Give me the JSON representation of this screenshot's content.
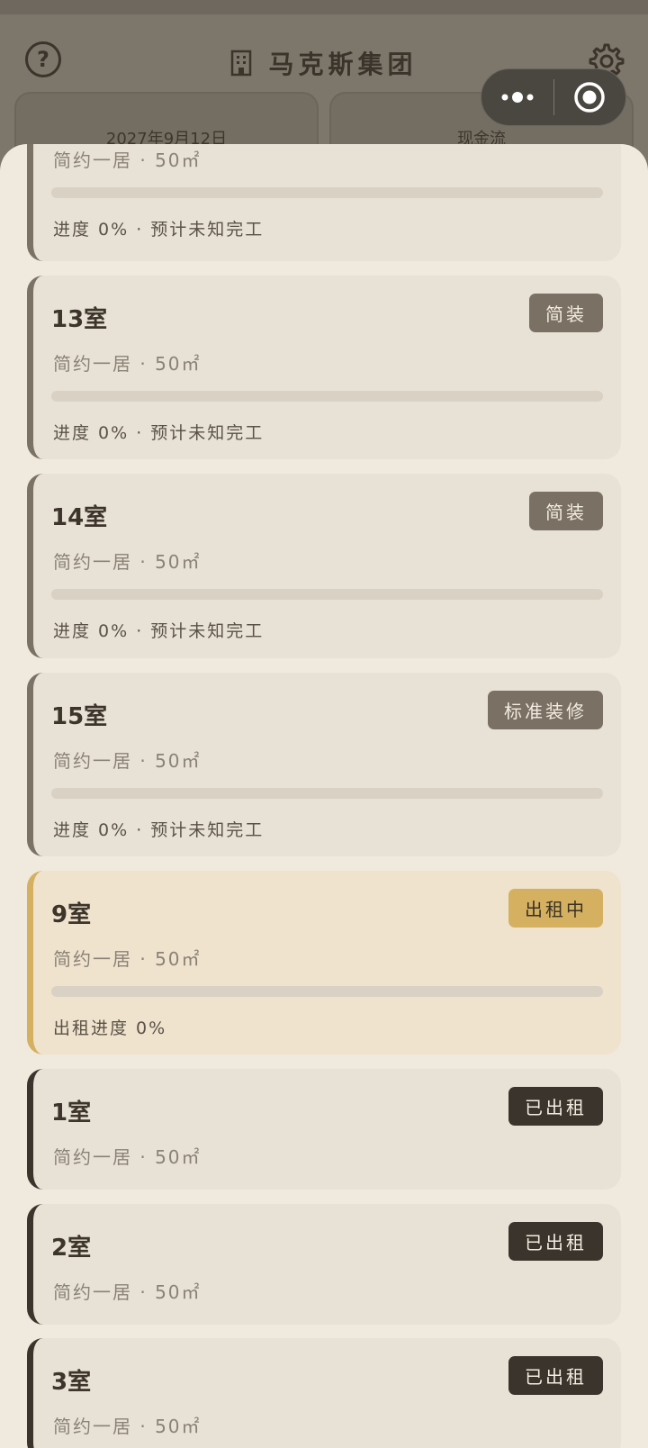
{
  "header": {
    "title": "马克斯集团",
    "help_symbol": "?",
    "date": "2027年9月12日",
    "cash_label": "现金流"
  },
  "icons": {
    "help": "help-circle-icon",
    "building": "building-icon",
    "settings": "gear-icon",
    "more": "more-dots-icon",
    "close": "capsule-close-icon"
  },
  "colors": {
    "accent_gold": "#d4b060",
    "dark": "#3a342c",
    "muted": "#7a7264",
    "sheet_bg": "#f0e9dd"
  },
  "rooms": [
    {
      "name": "",
      "desc": "简约一居 · 50㎡",
      "progress_text": "进度 0% · 预计未知完工",
      "progress": 0,
      "badge": ""
    },
    {
      "name": "13室",
      "desc": "简约一居 · 50㎡",
      "progress_text": "进度 0% · 预计未知完工",
      "progress": 0,
      "badge": "简装"
    },
    {
      "name": "14室",
      "desc": "简约一居 · 50㎡",
      "progress_text": "进度 0% · 预计未知完工",
      "progress": 0,
      "badge": "简装"
    },
    {
      "name": "15室",
      "desc": "简约一居 · 50㎡",
      "progress_text": "进度 0% · 预计未知完工",
      "progress": 0,
      "badge": "标准装修"
    },
    {
      "name": "9室",
      "desc": "简约一居 · 50㎡",
      "progress_text": "出租进度 0%",
      "progress": 0,
      "badge": "出租中"
    },
    {
      "name": "1室",
      "desc": "简约一居 · 50㎡",
      "progress_text": "",
      "badge": "已出租"
    },
    {
      "name": "2室",
      "desc": "简约一居 · 50㎡",
      "progress_text": "",
      "badge": "已出租"
    },
    {
      "name": "3室",
      "desc": "简约一居 · 50㎡",
      "progress_text": "",
      "badge": "已出租"
    }
  ]
}
